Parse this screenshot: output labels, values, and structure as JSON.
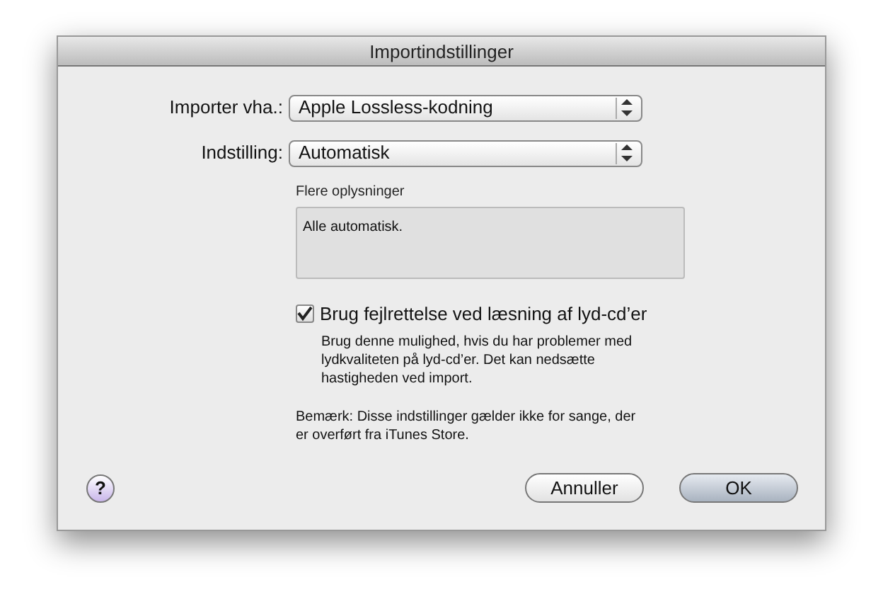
{
  "window": {
    "title": "Importindstillinger"
  },
  "fields": [
    {
      "label": "Importer vha.:",
      "value": "Apple Lossless-kodning"
    },
    {
      "label": "Indstilling:",
      "value": "Automatisk"
    }
  ],
  "details": {
    "label": "Flere oplysninger",
    "text": "Alle automatisk."
  },
  "error_correction": {
    "label": "Brug fejlrettelse ved læsning af lyd-cd’er",
    "checked": true,
    "description": "Brug denne mulighed, hvis du har problemer med lydkvaliteten på lyd-cd’er. Det kan nedsætte hastigheden ved import."
  },
  "note": "Bemærk: Disse indstillinger gælder ikke for sange, der er overført fra iTunes Store.",
  "help": "?",
  "buttons": [
    {
      "label": "Annuller",
      "default": false
    },
    {
      "label": "OK",
      "default": true
    }
  ]
}
